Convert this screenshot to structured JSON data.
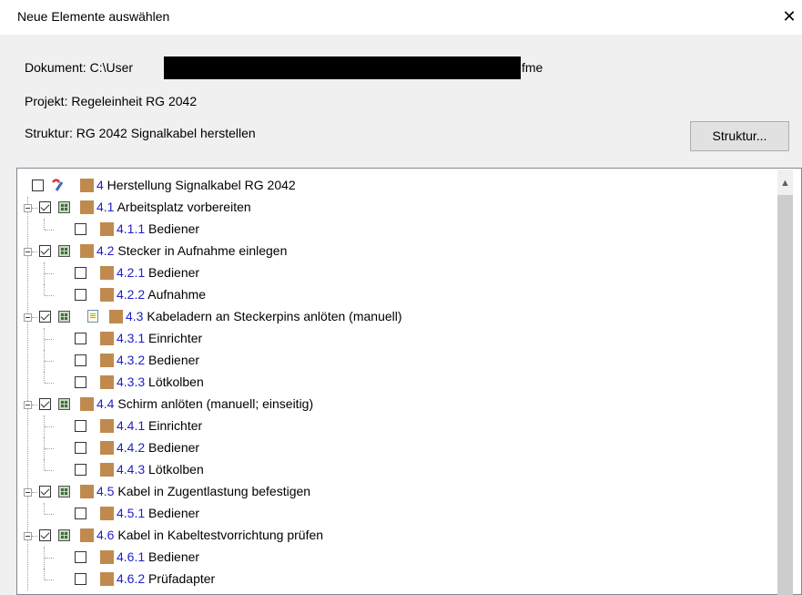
{
  "window": {
    "title": "Neue Elemente auswählen",
    "close_glyph": "✕"
  },
  "info": {
    "dokument_prefix": "Dokument: C:\\User",
    "dokument_suffix": "fme",
    "projekt": "Projekt: Regeleinheit RG 2042",
    "struktur": "Struktur: RG 2042 Signalkabel herstellen"
  },
  "buttons": {
    "struktur": "Struktur..."
  },
  "colors": {
    "number_link": "#1e1ec8",
    "folder": "#c08a4f"
  },
  "tree": {
    "root": {
      "number": "4",
      "label": "Herstellung Signalkabel RG 2042",
      "checked": false
    },
    "items": [
      {
        "number": "4.1",
        "label": "Arbeitsplatz vorbereiten",
        "level": 1,
        "checked": true
      },
      {
        "number": "4.1.1",
        "label": "Bediener",
        "level": 2,
        "checked": false
      },
      {
        "number": "4.2",
        "label": "Stecker in Aufnahme einlegen",
        "level": 1,
        "checked": true
      },
      {
        "number": "4.2.1",
        "label": "Bediener",
        "level": 2,
        "checked": false
      },
      {
        "number": "4.2.2",
        "label": "Aufnahme",
        "level": 2,
        "checked": false
      },
      {
        "number": "4.3",
        "label": "Kabeladern an Steckerpins anlöten (manuell)",
        "level": 1,
        "checked": true,
        "doc_icon": true
      },
      {
        "number": "4.3.1",
        "label": "Einrichter",
        "level": 2,
        "checked": false
      },
      {
        "number": "4.3.2",
        "label": "Bediener",
        "level": 2,
        "checked": false
      },
      {
        "number": "4.3.3",
        "label": "Lötkolben",
        "level": 2,
        "checked": false
      },
      {
        "number": "4.4",
        "label": "Schirm anlöten (manuell; einseitig)",
        "level": 1,
        "checked": true
      },
      {
        "number": "4.4.1",
        "label": "Einrichter",
        "level": 2,
        "checked": false
      },
      {
        "number": "4.4.2",
        "label": "Bediener",
        "level": 2,
        "checked": false
      },
      {
        "number": "4.4.3",
        "label": "Lötkolben",
        "level": 2,
        "checked": false
      },
      {
        "number": "4.5",
        "label": "Kabel in Zugentlastung befestigen",
        "level": 1,
        "checked": true
      },
      {
        "number": "4.5.1",
        "label": "Bediener",
        "level": 2,
        "checked": false
      },
      {
        "number": "4.6",
        "label": "Kabel in Kabeltestvorrichtung prüfen",
        "level": 1,
        "checked": true
      },
      {
        "number": "4.6.1",
        "label": "Bediener",
        "level": 2,
        "checked": false
      },
      {
        "number": "4.6.2",
        "label": "Prüfadapter",
        "level": 2,
        "checked": false
      }
    ]
  }
}
